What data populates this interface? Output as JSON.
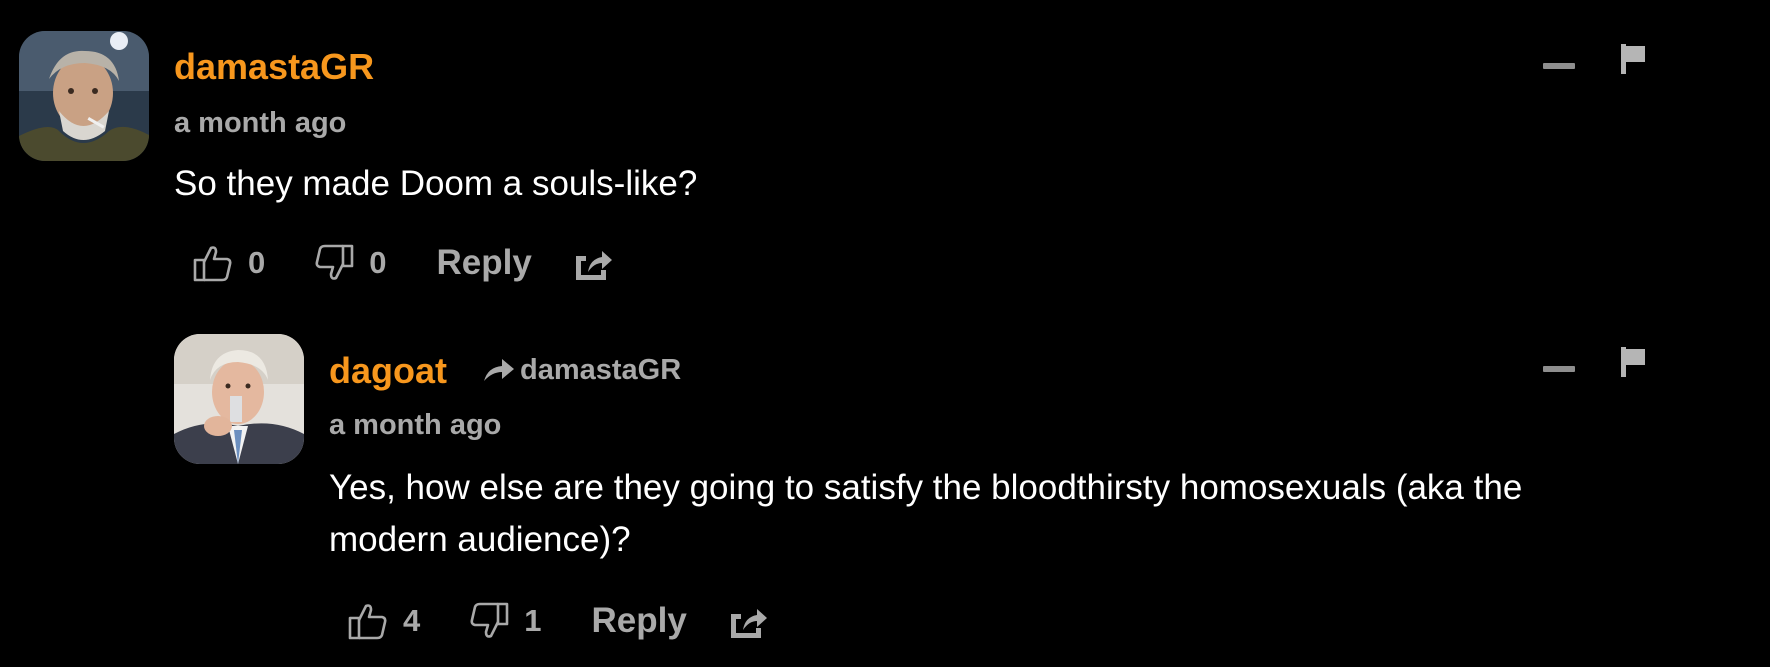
{
  "comments": [
    {
      "username": "damastaGR",
      "timestamp": "a month ago",
      "text": "So they made Doom a souls-like?",
      "likes": "0",
      "dislikes": "0",
      "reply_label": "Reply"
    },
    {
      "username": "dagoat",
      "reply_to": "damastaGR",
      "timestamp": "a month ago",
      "text": "Yes, how else are they going to satisfy the bloodthirsty homosexuals (aka the modern audience)?",
      "likes": "4",
      "dislikes": "1",
      "reply_label": "Reply"
    }
  ],
  "icons": {
    "like": "thumbs-up-icon",
    "dislike": "thumbs-down-icon",
    "share": "share-icon",
    "collapse": "minus-icon",
    "flag": "flag-icon",
    "reply_arrow": "reply-arrow-icon"
  },
  "colors": {
    "background": "#000000",
    "username": "#f7971d",
    "muted": "#a9a9a9",
    "text": "#ffffff"
  }
}
